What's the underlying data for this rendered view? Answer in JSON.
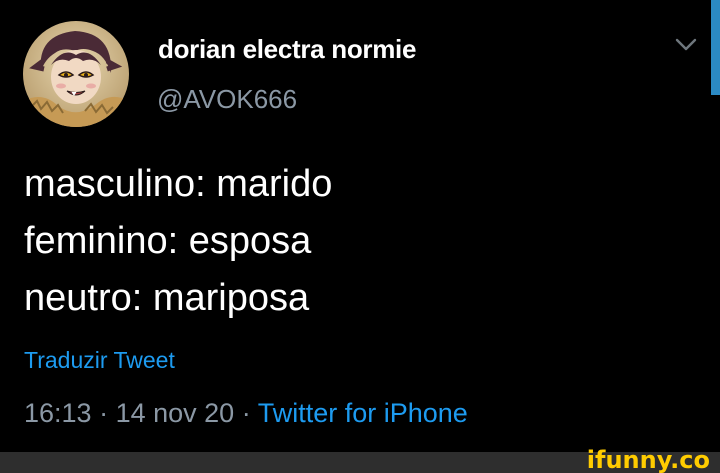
{
  "tweet": {
    "display_name": "dorian electra normie",
    "handle": "@AVOK666",
    "lines": [
      "masculino: marido",
      "feminino: esposa",
      "neutro: mariposa"
    ],
    "translate_label": "Traduzir Tweet",
    "time": "16:13",
    "date": "14 nov 20",
    "separator": " · ",
    "client": "Twitter for iPhone"
  },
  "icons": {
    "more": "chevron-down-icon",
    "avatar": "profile-avatar"
  },
  "colors": {
    "background": "#000000",
    "text": "#ffffff",
    "muted": "#8b98a5",
    "accent": "#1d9bf0",
    "watermark": "#ffcc00"
  },
  "watermark": "ifunny.co"
}
